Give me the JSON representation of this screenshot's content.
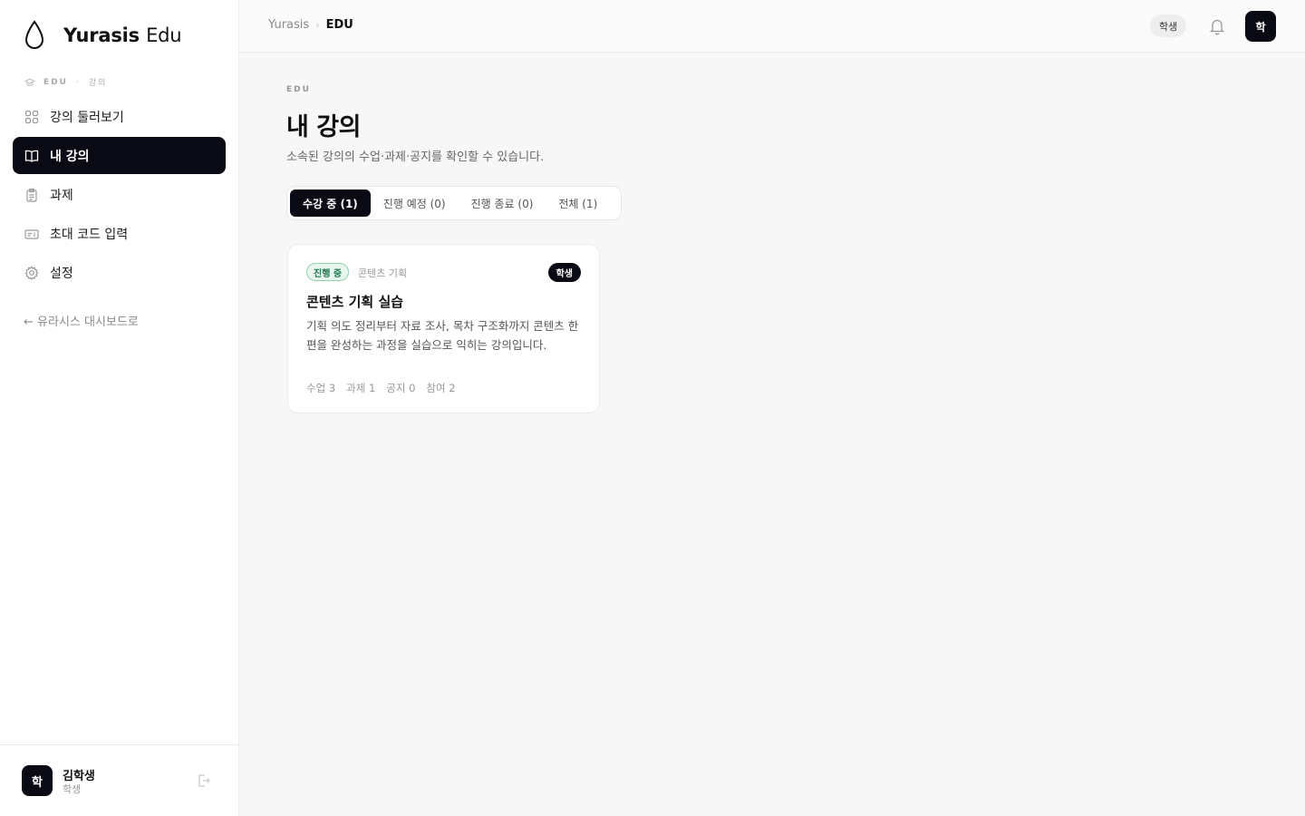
{
  "sidebar": {
    "brand_bold": "Yurasis",
    "brand_light": "Edu",
    "section_edu": "EDU",
    "section_course": "강의",
    "items": [
      {
        "label": "강의 둘러보기",
        "icon": "grid-icon"
      },
      {
        "label": "내 강의",
        "icon": "book-icon",
        "active": true
      },
      {
        "label": "과제",
        "icon": "clipboard-icon"
      },
      {
        "label": "초대 코드 입력",
        "icon": "ticket-icon"
      },
      {
        "label": "설정",
        "icon": "gear-icon"
      }
    ],
    "back_link": "← 유라시스 대시보드로",
    "user": {
      "avatar": "학",
      "name": "김학생",
      "role": "학생"
    }
  },
  "header": {
    "breadcrumb_root": "Yurasis",
    "breadcrumb_sep": "›",
    "breadcrumb_current": "EDU",
    "role_chip": "학생",
    "avatar": "학"
  },
  "main": {
    "eyebrow": "EDU",
    "title": "내 강의",
    "description": "소속된 강의의 수업·과제·공지를 확인할 수 있습니다.",
    "tabs": [
      {
        "label": "수강 중 (1)",
        "active": true
      },
      {
        "label": "진행 예정 (0)"
      },
      {
        "label": "진행 종료 (0)"
      },
      {
        "label": "전체 (1)"
      }
    ],
    "course": {
      "status": "진행 중",
      "category": "콘텐츠 기획",
      "role": "학생",
      "title": "콘텐츠 기획 실습",
      "description": "기획 의도 정리부터 자료 조사, 목차 구조화까지 콘텐츠 한 편을 완성하는 과정을 실습으로 익히는 강의입니다.",
      "stats": [
        "수업 3",
        "과제 1",
        "공지 0",
        "참여 2"
      ]
    }
  },
  "colors": {
    "primary": "#0a0a14",
    "status_green": "#1a7a4c",
    "status_green_bg": "#e8f6ef"
  }
}
